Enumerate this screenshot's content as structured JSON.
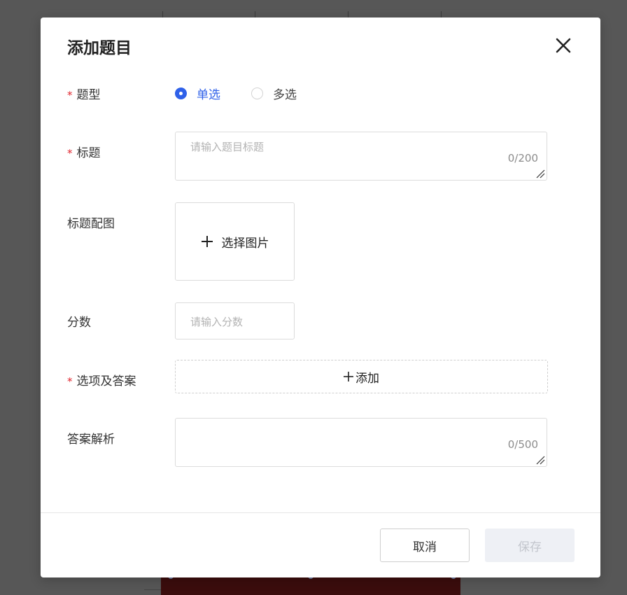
{
  "dialog": {
    "title": "添加题目",
    "close_icon": "close-icon"
  },
  "form": {
    "type": {
      "label": "题型",
      "required": true,
      "options": [
        {
          "label": "单选",
          "selected": true
        },
        {
          "label": "多选",
          "selected": false
        }
      ]
    },
    "title_field": {
      "label": "标题",
      "required": true,
      "placeholder": "请输入题目标题",
      "counter": "0/200"
    },
    "title_image": {
      "label": "标题配图",
      "button_label": "选择图片",
      "icon": "plus-icon"
    },
    "score": {
      "label": "分数",
      "placeholder": "请输入分数"
    },
    "options_answer": {
      "label": "选项及答案",
      "required": true,
      "add_label": "添加",
      "icon": "plus-icon"
    },
    "analysis": {
      "label": "答案解析",
      "counter": "0/500"
    },
    "required_mark": "*"
  },
  "footer": {
    "cancel_label": "取消",
    "save_label": "保存"
  },
  "colors": {
    "accent": "#2f61e9",
    "required": "#e0242c",
    "disabled_bg": "#eef0f5",
    "disabled_text": "#c3c6cd"
  }
}
